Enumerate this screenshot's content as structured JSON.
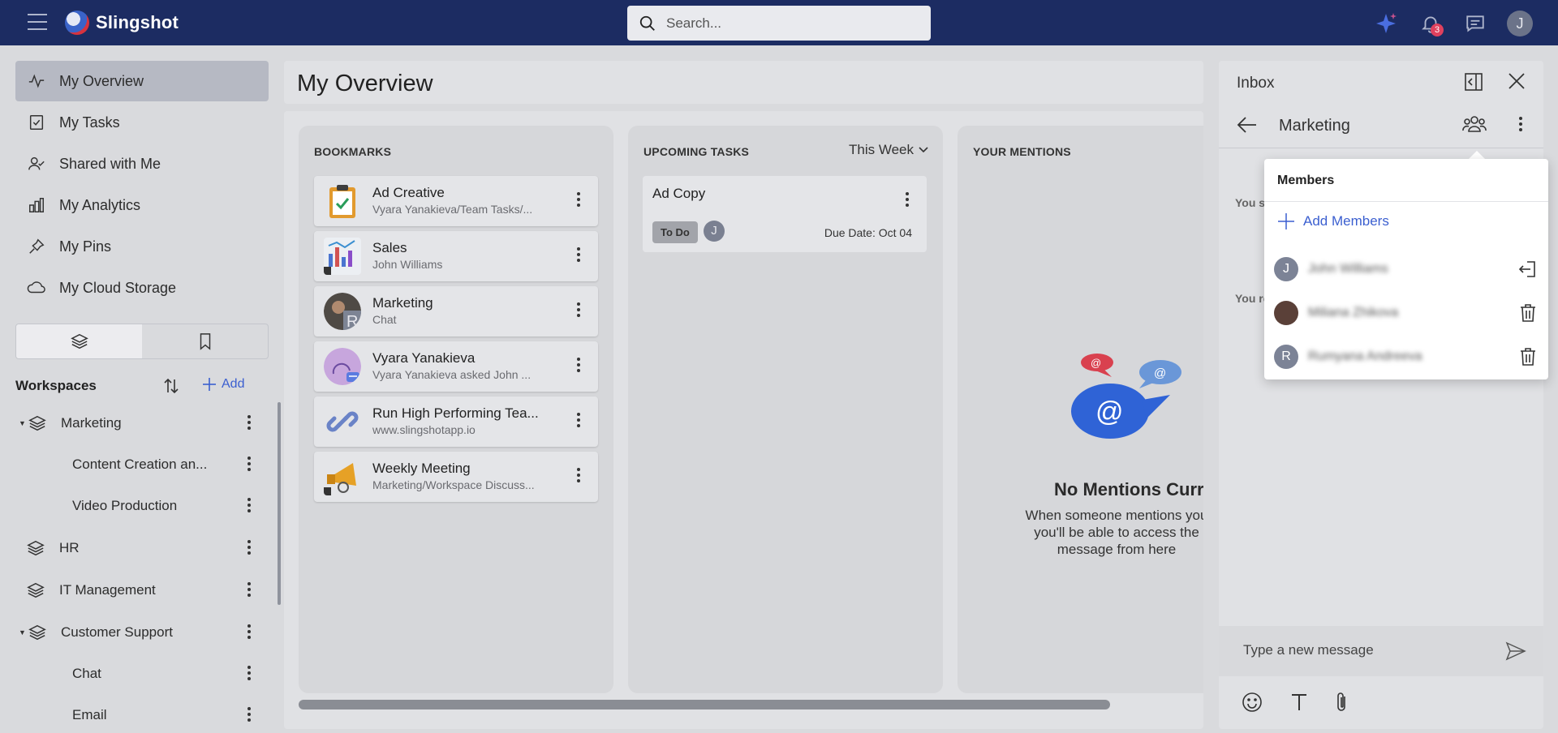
{
  "app": {
    "name": "Slingshot",
    "search_placeholder": "Search...",
    "notification_count": "3",
    "user_initial": "J"
  },
  "nav": {
    "items": [
      {
        "label": "My Overview",
        "icon": "activity-icon"
      },
      {
        "label": "My Tasks",
        "icon": "task-checkbox-icon"
      },
      {
        "label": "Shared with Me",
        "icon": "user-check-icon"
      },
      {
        "label": "My Analytics",
        "icon": "bar-chart-icon"
      },
      {
        "label": "My Pins",
        "icon": "pin-icon"
      },
      {
        "label": "My Cloud Storage",
        "icon": "cloud-icon"
      }
    ]
  },
  "workspaces": {
    "title": "Workspaces",
    "add_label": "Add",
    "items": [
      {
        "label": "Marketing"
      },
      {
        "label": "Content Creation an..."
      },
      {
        "label": "Video Production"
      },
      {
        "label": "HR"
      },
      {
        "label": "IT Management"
      },
      {
        "label": "Customer Support"
      },
      {
        "label": "Chat"
      },
      {
        "label": "Email"
      }
    ]
  },
  "main": {
    "title": "My Overview",
    "bookmarks": {
      "title": "BOOKMARKS",
      "items": [
        {
          "title": "Ad Creative",
          "subtitle": "Vyara Yanakieva/Team Tasks/..."
        },
        {
          "title": "Sales",
          "subtitle": "John Williams"
        },
        {
          "title": "Marketing",
          "subtitle": "Chat"
        },
        {
          "title": "Vyara Yanakieva",
          "subtitle": "Vyara Yanakieva asked John ..."
        },
        {
          "title": "Run High Performing Tea...",
          "subtitle": "www.slingshotapp.io"
        },
        {
          "title": "Weekly Meeting",
          "subtitle": "Marketing/Workspace Discuss..."
        }
      ]
    },
    "tasks": {
      "title": "UPCOMING TASKS",
      "filter": "This Week",
      "items": [
        {
          "title": "Ad Copy",
          "status": "To Do",
          "assignee_initial": "J",
          "due": "Due Date:  Oct 04"
        }
      ]
    },
    "mentions": {
      "title": "YOUR MENTIONS",
      "empty_title": "No Mentions Currently",
      "empty_text": "When someone mentions you you'll be able to access the message from here"
    }
  },
  "inbox": {
    "title": "Inbox",
    "conversation": "Marketing",
    "faded_1": "You s",
    "faded_2": "You re",
    "composer_placeholder": "Type a new message"
  },
  "members": {
    "title": "Members",
    "add_label": "Add Members",
    "list": [
      {
        "initial": "J",
        "name": "John Williams",
        "action": "leave-icon"
      },
      {
        "initial": "",
        "name": "Miliana Zhikova",
        "action": "trash-icon"
      },
      {
        "initial": "R",
        "name": "Rumyana Andreeva",
        "action": "trash-icon"
      }
    ]
  },
  "colors": {
    "topbar": "#1c2c62",
    "accent": "#3b5fd0",
    "badge": "#e0415e"
  }
}
